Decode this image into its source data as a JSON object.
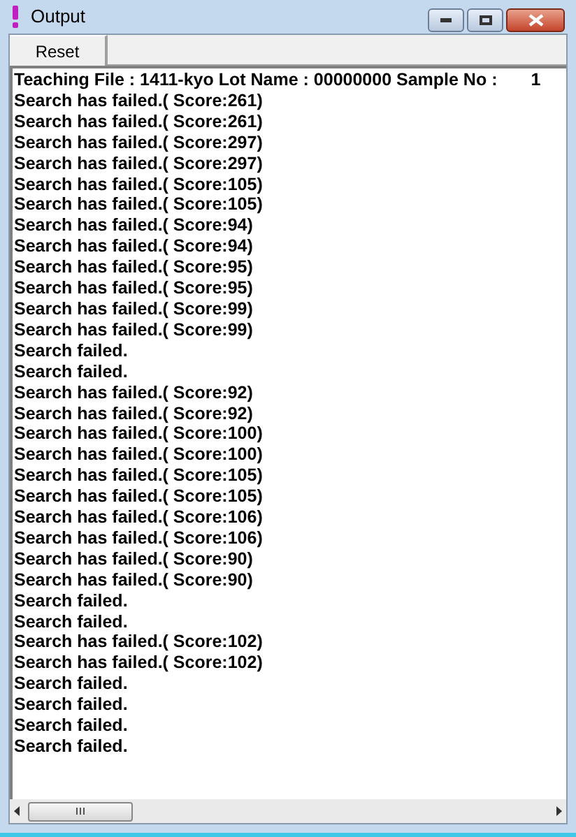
{
  "window": {
    "title": "Output"
  },
  "toolbar": {
    "buttons": [
      "Reset"
    ]
  },
  "output": {
    "header": {
      "label": "Teaching File : 1411-kyo Lot Name : 00000000 Sample No :",
      "value": "1"
    },
    "lines": [
      "Search has failed.( Score:261)",
      "Search has failed.( Score:261)",
      "Search has failed.( Score:297)",
      "Search has failed.( Score:297)",
      "Search has failed.( Score:105)",
      "Search has failed.( Score:105)",
      "Search has failed.( Score:94)",
      "Search has failed.( Score:94)",
      "Search has failed.( Score:95)",
      "Search has failed.( Score:95)",
      "Search has failed.( Score:99)",
      "Search has failed.( Score:99)",
      "Search failed.",
      "Search failed.",
      "Search has failed.( Score:92)",
      "Search has failed.( Score:92)",
      "Search has failed.( Score:100)",
      "Search has failed.( Score:100)",
      "Search has failed.( Score:105)",
      "Search has failed.( Score:105)",
      "Search has failed.( Score:106)",
      "Search has failed.( Score:106)",
      "Search has failed.( Score:90)",
      "Search has failed.( Score:90)",
      "Search failed.",
      "Search failed.",
      "Search has failed.( Score:102)",
      "Search has failed.( Score:102)",
      "Search failed.",
      "Search failed.",
      "Search failed.",
      "Search failed."
    ]
  }
}
